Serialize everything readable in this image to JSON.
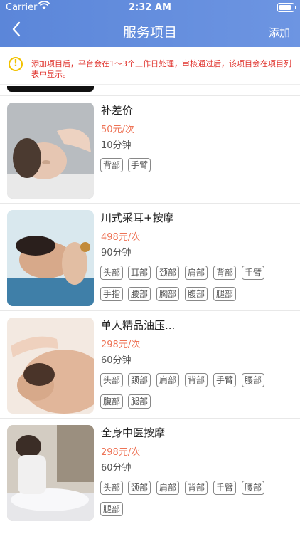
{
  "status": {
    "carrier": "Carrier",
    "time": "2:32 AM"
  },
  "nav": {
    "back_icon": "chevron-left-icon",
    "title": "服务项目",
    "add_label": "添加"
  },
  "notice": {
    "icon": "alert-circle-icon",
    "text": "添加项目后，平台会在1～3个工作日处理，审核通过后，该项目会在项目列表中显示。"
  },
  "services": [
    {
      "title": "补差价",
      "price": "50元/次",
      "duration": "10分钟",
      "tags": [
        "背部",
        "手臂"
      ]
    },
    {
      "title": "川式采耳+按摩",
      "price": "498元/次",
      "duration": "90分钟",
      "tags": [
        "头部",
        "耳部",
        "颈部",
        "肩部",
        "背部",
        "手臂",
        "手指",
        "腰部",
        "胸部",
        "腹部",
        "腿部"
      ]
    },
    {
      "title": "单人精品油压...",
      "price": "298元/次",
      "duration": "60分钟",
      "tags": [
        "头部",
        "颈部",
        "肩部",
        "背部",
        "手臂",
        "腰部",
        "腹部",
        "腿部"
      ]
    },
    {
      "title": "全身中医按摩",
      "price": "298元/次",
      "duration": "60分钟",
      "tags": [
        "头部",
        "颈部",
        "肩部",
        "背部",
        "手臂",
        "腰部",
        "腿部"
      ]
    }
  ]
}
